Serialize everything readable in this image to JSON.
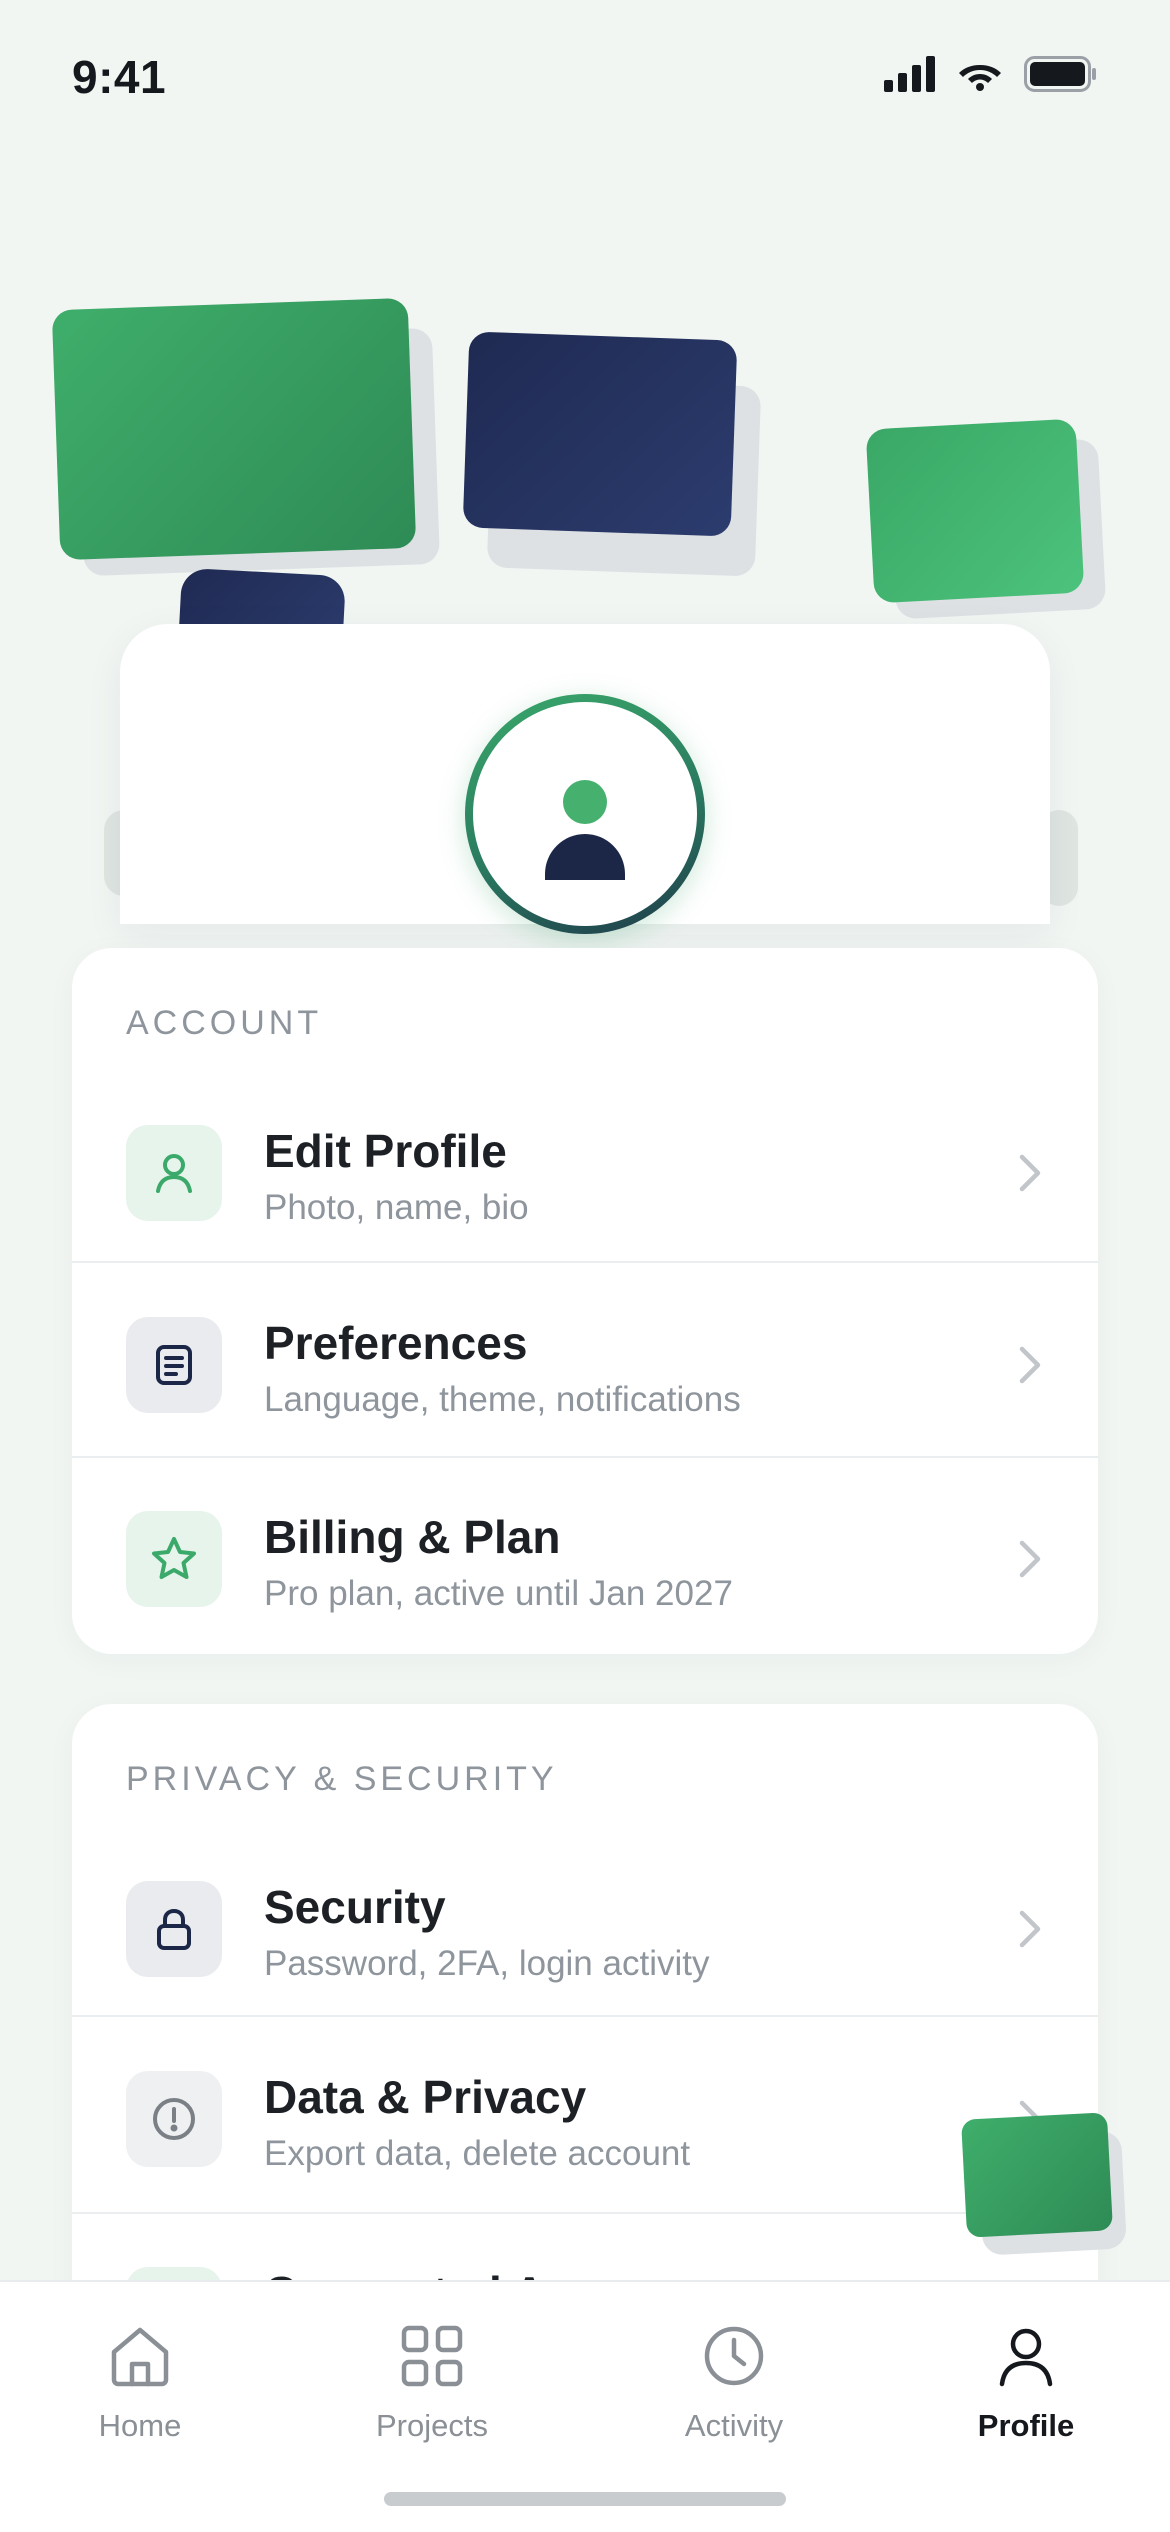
{
  "status_bar": {
    "time": "9:41"
  },
  "sections": [
    {
      "heading": "ACCOUNT",
      "rows": [
        {
          "title": "Edit Profile",
          "subtitle": "Photo, name, bio",
          "icon": "user-icon"
        },
        {
          "title": "Preferences",
          "subtitle": "Language, theme, notifications",
          "icon": "document-icon"
        },
        {
          "title": "Billing & Plan",
          "subtitle": "Pro plan, active until Jan 2027",
          "icon": "star-icon"
        }
      ]
    },
    {
      "heading": "PRIVACY & SECURITY",
      "rows": [
        {
          "title": "Security",
          "subtitle": "Password, 2FA, login activity",
          "icon": "lock-icon"
        },
        {
          "title": "Data & Privacy",
          "subtitle": "Export data, delete account",
          "icon": "alert-circle-icon"
        },
        {
          "title": "Connected A",
          "subtitle": "",
          "icon": "link-icon"
        }
      ]
    }
  ],
  "bottom_nav": {
    "items": [
      {
        "label": "Home",
        "icon": "home-icon",
        "active": false
      },
      {
        "label": "Projects",
        "icon": "grid-icon",
        "active": false
      },
      {
        "label": "Activity",
        "icon": "clock-icon",
        "active": false
      },
      {
        "label": "Profile",
        "icon": "user-icon",
        "active": true
      }
    ]
  },
  "colors": {
    "background": "#f1f6f3",
    "accent_green": "#3aa96a",
    "navy": "#1c2748",
    "text_primary": "#1d2126",
    "text_secondary": "#8e959c"
  }
}
